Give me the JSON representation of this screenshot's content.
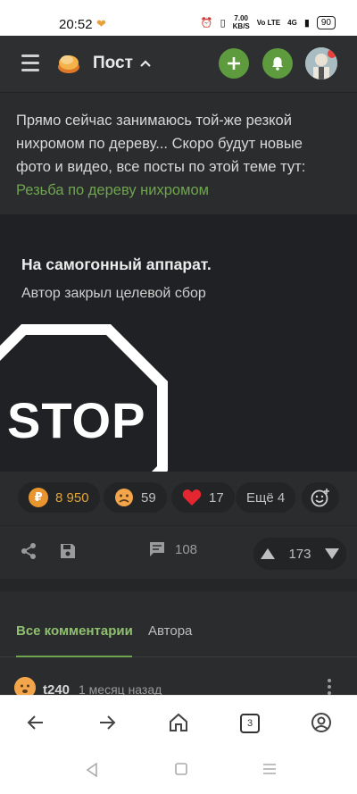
{
  "status_bar": {
    "time": "20:52",
    "net_speed_value": "7.00",
    "net_speed_unit": "KB/S",
    "volte": "Vo LTE",
    "signal_label": "4G",
    "battery": "90"
  },
  "app_bar": {
    "title": "Пост"
  },
  "post": {
    "text": "Прямо сейчас занимаюсь той-же резкой нихромом по дереву... Скоро будут новые фото и видео, все посты по этой теме тут:",
    "link_text": "Резьба по дереву нихромом"
  },
  "donation": {
    "title": "На самогонный аппарат.",
    "subtitle": "Автор закрыл целевой сбор",
    "stop_text": "STOP"
  },
  "reactions": {
    "donations": "8 950",
    "sad_count": "59",
    "heart_count": "17",
    "more": "Ещё 4"
  },
  "actions": {
    "comments_count": "108",
    "rating": "173"
  },
  "comments": {
    "tab_all": "Все комментарии",
    "tab_author": "Автора",
    "first": {
      "user": "t240",
      "time": "1 месяц назад"
    }
  },
  "browser": {
    "tabs_count": "3"
  },
  "colors": {
    "accent_green": "#5e9b3e",
    "link_green": "#6ea54e",
    "donation_gold": "#e0a53d"
  }
}
